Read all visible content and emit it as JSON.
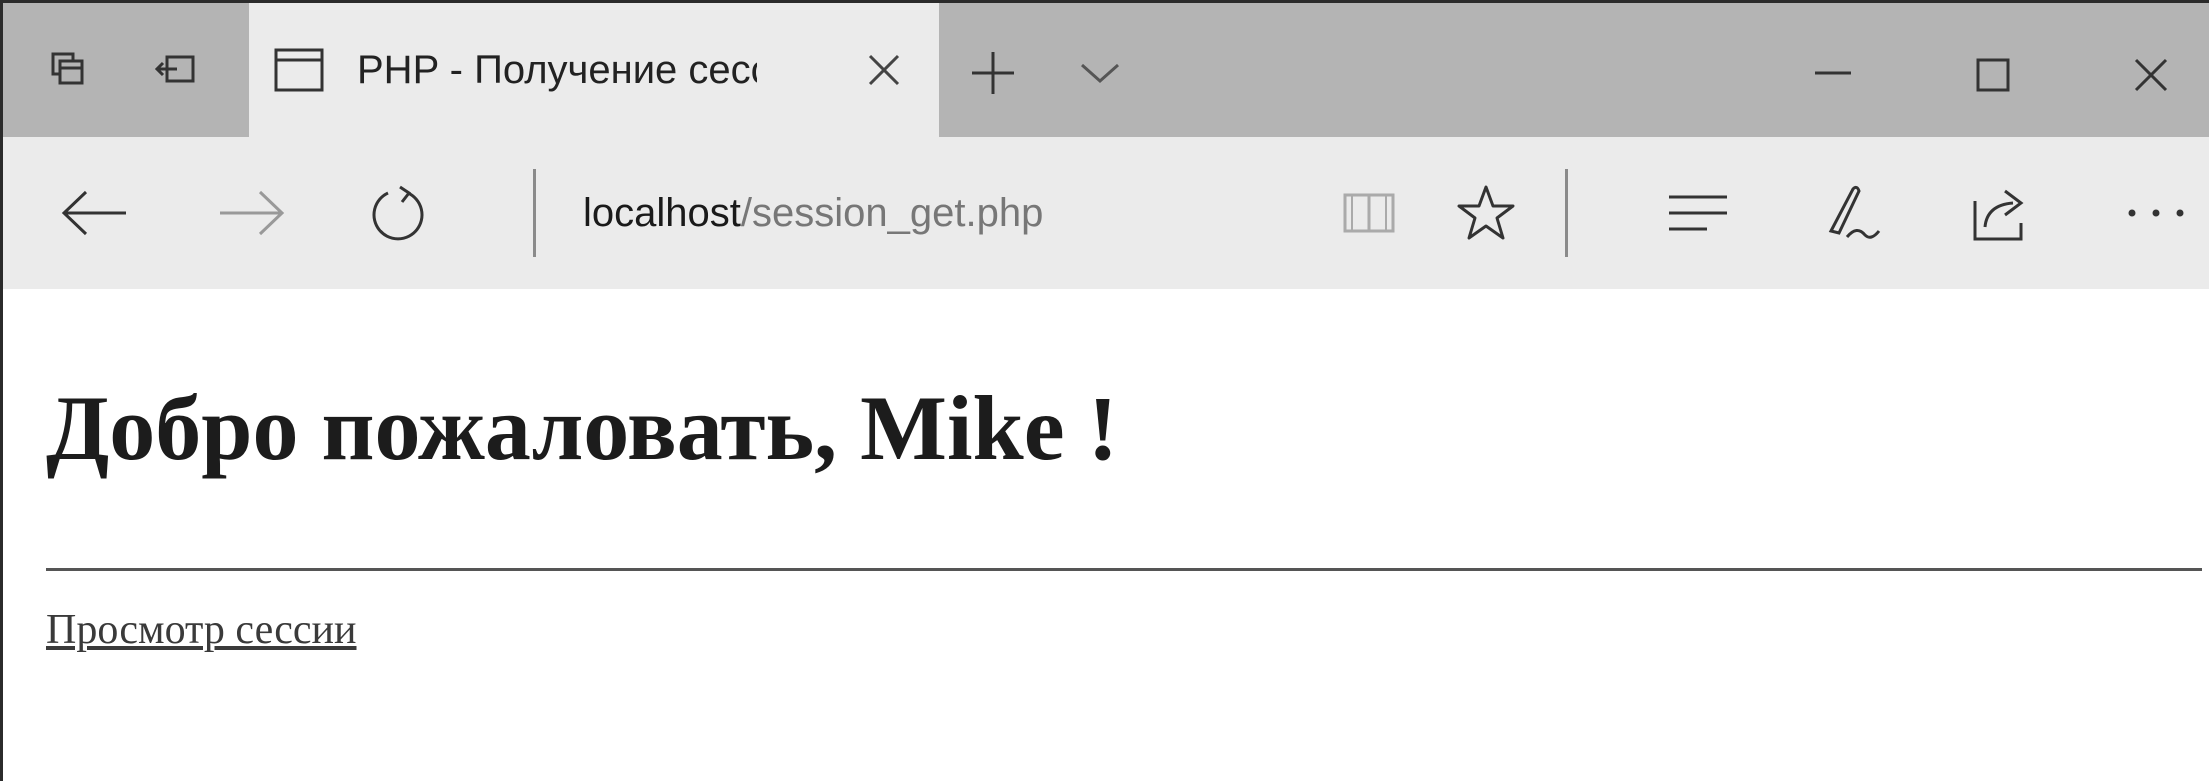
{
  "window": {
    "controls": {
      "minimize": "minimize-icon",
      "maximize": "maximize-icon",
      "close": "close-icon"
    }
  },
  "tabs": {
    "preview_icon": "tab-preview-icon",
    "back_to_tabs_icon": "set-aside-tabs-icon",
    "active": {
      "title": "PHP - Получение сесси",
      "icon": "page-icon"
    },
    "new_tab_icon": "plus-icon",
    "tab_list_icon": "chevron-down-icon"
  },
  "toolbar": {
    "back": "back-arrow-icon",
    "forward": "forward-arrow-icon",
    "refresh": "refresh-icon",
    "url": {
      "host": "localhost",
      "path": "/session_get.php"
    },
    "reading_view": "reading-view-icon",
    "favorite": "star-icon",
    "hub": "hub-icon",
    "web_note": "pen-icon",
    "share": "share-icon",
    "more": "more-icon"
  },
  "page": {
    "heading": "Добро пожаловать, Mike !",
    "link": "Просмотр сессии"
  },
  "colors": {
    "tabbar_bg": "#b4b4b4",
    "active_tab_bg": "#ebebeb",
    "navbar_bg": "#ebebeb",
    "frame": "#2b2b2b"
  }
}
